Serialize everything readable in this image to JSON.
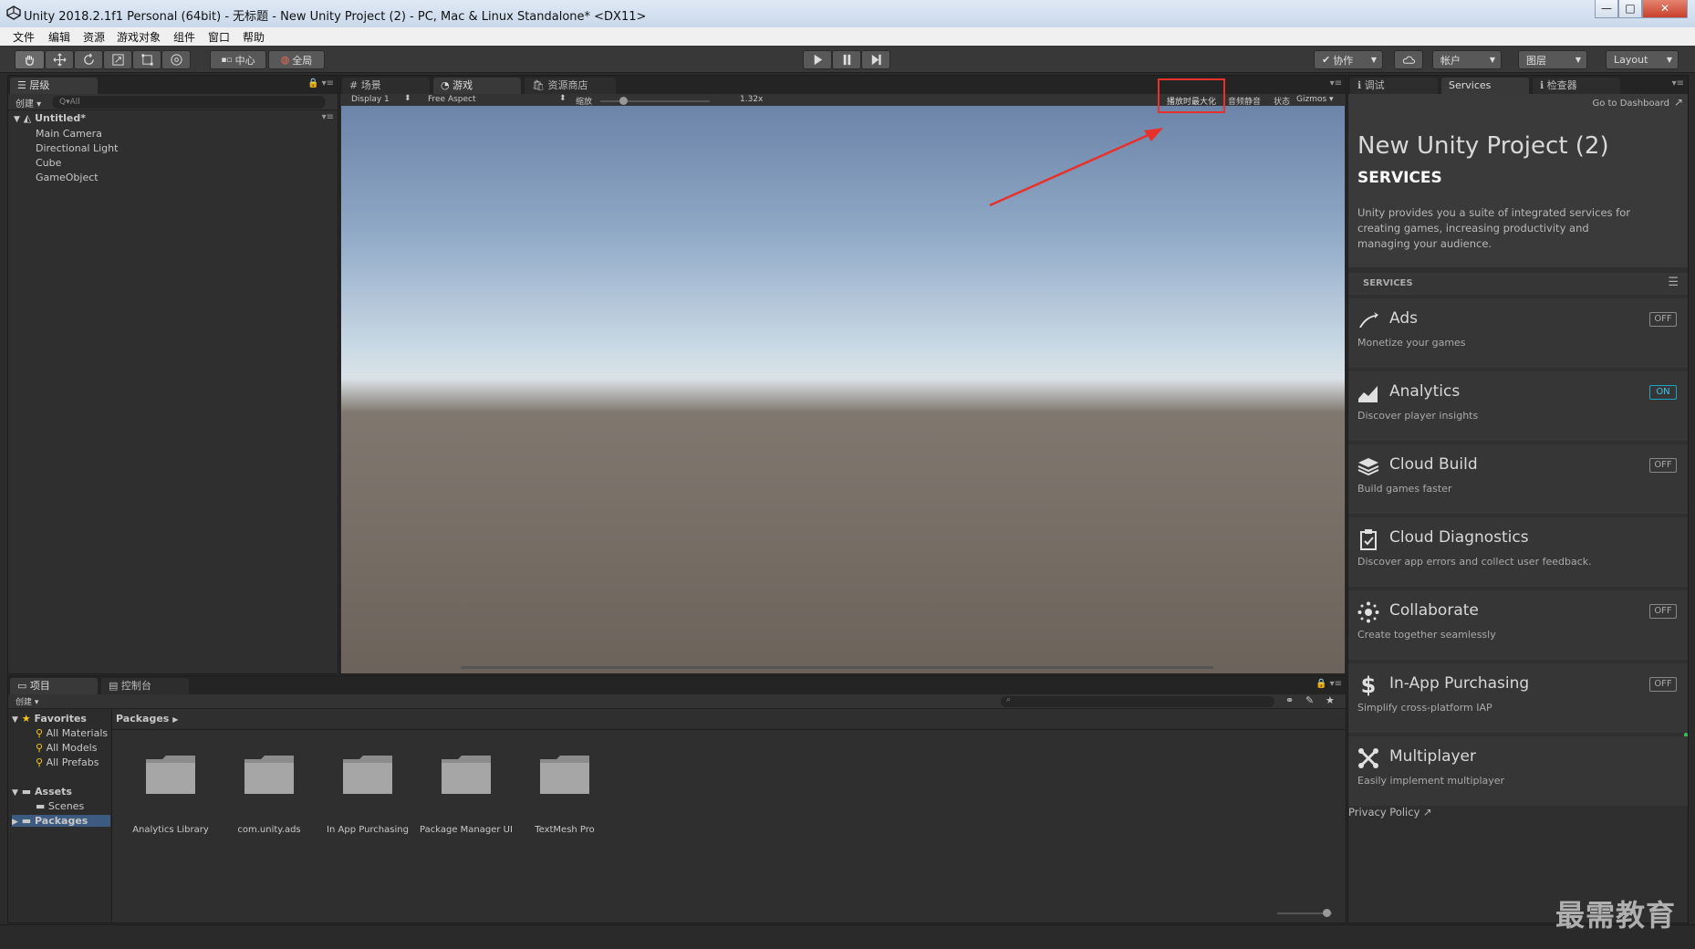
{
  "window": {
    "title": "Unity 2018.2.1f1 Personal (64bit) - 无标题 - New Unity Project (2) - PC, Mac & Linux Standalone* <DX11>",
    "minimize": "—",
    "maximize": "□",
    "close": "✕"
  },
  "menu": [
    "文件",
    "编辑",
    "资源",
    "游戏对象",
    "组件",
    "窗口",
    "帮助"
  ],
  "toolbar": {
    "pivot_label": "中心",
    "global_label": "全局",
    "collab_label": "协作",
    "account_label": "帐户",
    "layers_label": "图层",
    "layout_label": "Layout"
  },
  "hierarchy": {
    "tab_label": "层级",
    "create_label": "创建",
    "search_placeholder": "Q▾All",
    "scene_name": "Untitled*",
    "items": [
      "Main Camera",
      "Directional Light",
      "Cube",
      "GameObject"
    ]
  },
  "center_tabs": {
    "scene": "场景",
    "game": "游戏",
    "asset_store": "资源商店"
  },
  "game_toolbar": {
    "display": "Display 1",
    "aspect": "Free Aspect",
    "scale_label": "缩放",
    "scale_value": "1.32x",
    "maximize_on_play": "播放时最大化",
    "mute_audio": "音频静音",
    "stats": "状态",
    "gizmos": "Gizmos"
  },
  "right_tabs": {
    "debug": "调试",
    "services": "Services",
    "inspector": "检查器"
  },
  "services": {
    "dashboard_link": "Go to Dashboard",
    "project_name": "New Unity Project (2)",
    "heading": "SERVICES",
    "intro": "Unity provides you a suite of integrated services for creating games, increasing productivity and managing your audience.",
    "section_label": "SERVICES",
    "items": [
      {
        "name": "Ads",
        "desc": "Monetize your games",
        "toggle": "OFF",
        "icon": "ads-icon"
      },
      {
        "name": "Analytics",
        "desc": "Discover player insights",
        "toggle": "ON",
        "icon": "analytics-icon"
      },
      {
        "name": "Cloud Build",
        "desc": "Build games faster",
        "toggle": "OFF",
        "icon": "cloud-build-icon"
      },
      {
        "name": "Cloud Diagnostics",
        "desc": "Discover app errors and collect user feedback.",
        "toggle": "",
        "icon": "cloud-diagnostics-icon"
      },
      {
        "name": "Collaborate",
        "desc": "Create together seamlessly",
        "toggle": "OFF",
        "icon": "collaborate-icon"
      },
      {
        "name": "In-App Purchasing",
        "desc": "Simplify cross-platform IAP",
        "toggle": "OFF",
        "icon": "dollar-icon"
      },
      {
        "name": "Multiplayer",
        "desc": "Easily implement multiplayer",
        "toggle": "",
        "icon": "multiplayer-icon"
      }
    ],
    "privacy_policy": "Privacy Policy"
  },
  "project": {
    "tab_label": "项目",
    "console_tab": "控制台",
    "create_label": "创建",
    "favorites_label": "Favorites",
    "favorites": [
      "All Materials",
      "All Models",
      "All Prefabs"
    ],
    "assets_label": "Assets",
    "assets_children": [
      "Scenes"
    ],
    "packages_label": "Packages",
    "breadcrumb": "Packages",
    "folders": [
      "Analytics Library",
      "com.unity.ads",
      "In App Purchasing",
      "Package Manager UI",
      "TextMesh Pro"
    ]
  },
  "watermark": "最需教育",
  "colors": {
    "annotation_red": "#e8312a",
    "on_toggle": "#3cc7ee"
  }
}
